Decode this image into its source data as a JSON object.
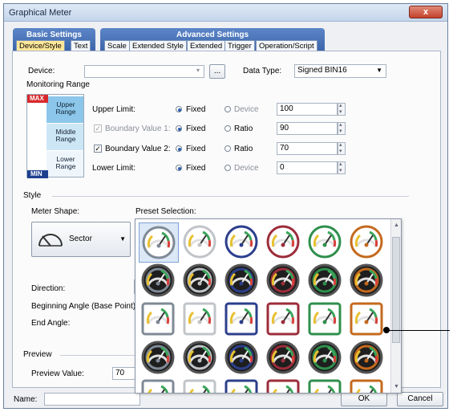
{
  "window": {
    "title": "Graphical Meter",
    "close_label": "x"
  },
  "tabs": {
    "basic_group": "Basic Settings",
    "advanced_group": "Advanced Settings",
    "items": [
      "Device/Style",
      "Text",
      "Scale",
      "Extended Style",
      "Extended",
      "Trigger",
      "Operation/Script"
    ]
  },
  "device": {
    "label": "Device:",
    "value": "",
    "browse_label": "...",
    "data_type_label": "Data Type:",
    "data_type_value": "Signed BIN16"
  },
  "monitoring": {
    "title": "Monitoring Range",
    "max_label": "MAX",
    "min_label": "MIN",
    "upper_range": "Upper Range",
    "middle_range": "Middle Range",
    "lower_range": "Lower Range",
    "rows": [
      {
        "label": "Upper Limit:",
        "opt1": "Fixed",
        "opt2": "Device",
        "value": "100"
      },
      {
        "label": "Boundary Value 1:",
        "opt1": "Fixed",
        "opt2": "Ratio",
        "value": "90"
      },
      {
        "label": "Boundary Value 2:",
        "opt1": "Fixed",
        "opt2": "Ratio",
        "value": "70"
      },
      {
        "label": "Lower Limit:",
        "opt1": "Fixed",
        "opt2": "Device",
        "value": "0"
      }
    ]
  },
  "style": {
    "title": "Style",
    "meter_shape_label": "Meter Shape:",
    "meter_shape_value": "Sector",
    "preset_label": "Preset Selection:",
    "direction_label": "Direction:",
    "beginning_angle_label": "Beginning Angle (Base Point):",
    "end_angle_label": "End Angle:"
  },
  "preview": {
    "title": "Preview",
    "value_label": "Preview Value:",
    "value": "70"
  },
  "footer": {
    "name_label": "Name:",
    "name_value": "",
    "ok_label": "OK",
    "cancel_label": "Cancel"
  },
  "presets": {
    "row_styles": [
      "light-round",
      "dark-round",
      "square-frame",
      "dark-ring",
      "square-frame"
    ],
    "accent_colors": [
      "#7f8a96",
      "#c0c4c8",
      "#2c3f8c",
      "#9c2d3a",
      "#2f8f4c",
      "#c46a1e"
    ]
  }
}
